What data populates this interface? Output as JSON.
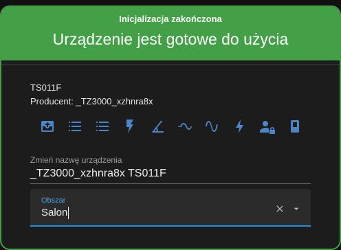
{
  "header": {
    "subtitle": "Inicjalizacja zakończona",
    "title": "Urządzenie jest gotowe do użycia",
    "color": "#43a047"
  },
  "device": {
    "name": "TS011F",
    "manufacturer_text": "Producent: _TZ3000_xzhnra8x"
  },
  "entity_icons": [
    "inbox-icon",
    "list-icon",
    "list-icon",
    "lightning-icon",
    "angle-icon",
    "sine-wave-icon",
    "ac-wave-icon",
    "flash-icon",
    "account-lock-icon",
    "battery-icon"
  ],
  "rename": {
    "label": "Zmień nazwę urządzenia",
    "value": "_TZ3000_xzhnra8x TS011F"
  },
  "area": {
    "label": "Obszar",
    "value": "Salon",
    "accent": "#1e90e0"
  },
  "icon_color": "#4a86c8"
}
